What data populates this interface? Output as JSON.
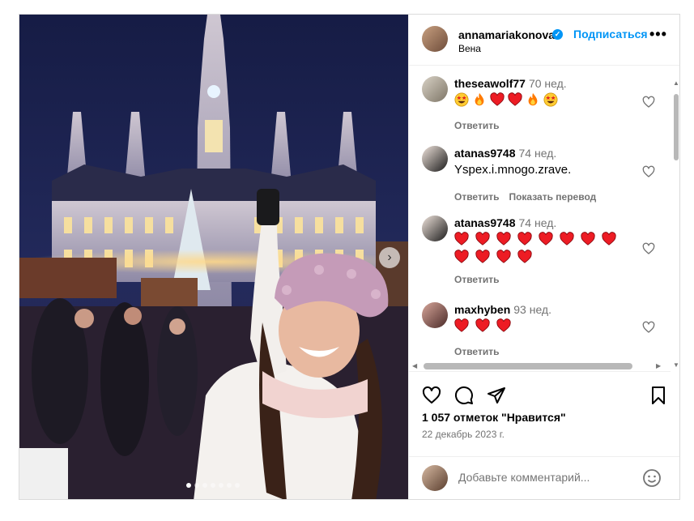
{
  "post": {
    "username": "annamariakonova",
    "follow_label": "Подписаться",
    "location": "Вена",
    "verified_icon": "verified-badge-icon",
    "more_icon": "more-options-icon",
    "likes": "1 057 отметок \"Нравится\"",
    "date": "22 декабрь 2023 г.",
    "carousel_total": 7,
    "carousel_active": 1
  },
  "comments": [
    {
      "user": "theseawolf77",
      "time": "70 нед.",
      "text": "",
      "emoji": [
        "star-struck",
        "fire",
        "red-heart",
        "red-heart",
        "fire",
        "star-struck"
      ],
      "actions": [
        "Ответить"
      ]
    },
    {
      "user": "atanas9748",
      "time": "74 нед.",
      "text": "Yspex.i.mnogo.zrave.",
      "emoji": [],
      "actions": [
        "Ответить",
        "Показать перевод"
      ]
    },
    {
      "user": "atanas9748",
      "time": "74 нед.",
      "text": "",
      "emoji": [
        "red-heart",
        "red-heart",
        "red-heart",
        "red-heart",
        "red-heart",
        "red-heart",
        "red-heart",
        "red-heart",
        "red-heart",
        "red-heart",
        "red-heart",
        "red-heart"
      ],
      "actions": [
        "Ответить"
      ]
    },
    {
      "user": "maxhyben",
      "time": "93 нед.",
      "text": "",
      "emoji": [
        "red-heart",
        "red-heart",
        "red-heart"
      ],
      "actions": [
        "Ответить"
      ]
    }
  ],
  "action_icons": [
    "like-icon",
    "comment-icon",
    "share-icon",
    "save-icon"
  ],
  "add_comment": {
    "placeholder": "Добавьте комментарий...",
    "emoji_icon": "emoji-icon"
  },
  "colors": {
    "accent": "#0095f6",
    "muted": "#737373",
    "border": "#dbdbdb",
    "heart": "#ed1c24"
  }
}
